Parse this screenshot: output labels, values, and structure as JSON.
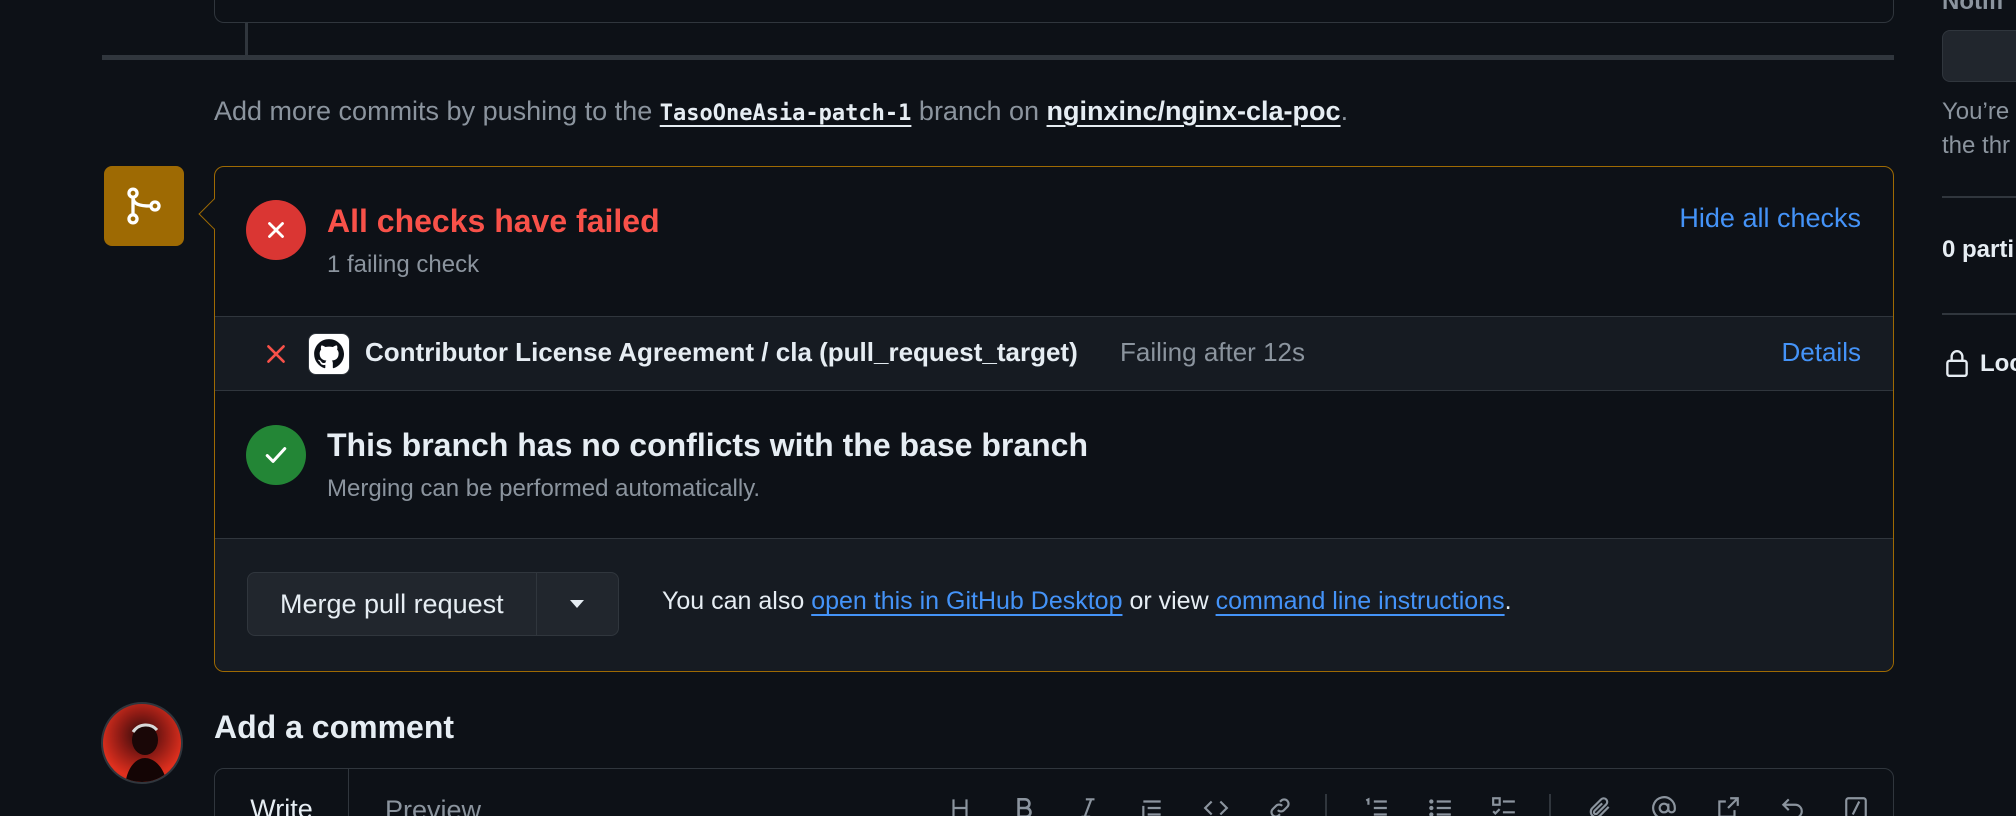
{
  "timeline": {
    "push_hint_prefix": "Add more commits by pushing to the",
    "branch_name": "TasoOneAsia-patch-1",
    "push_hint_middle": "branch on",
    "repo_name": "nginxinc/nginx-cla-poc",
    "push_hint_suffix": "."
  },
  "merge_box": {
    "checks": {
      "title": "All checks have failed",
      "subtitle": "1 failing check",
      "toggle_label": "Hide all checks",
      "items": [
        {
          "name": "Contributor License Agreement / cla (pull_request_target)",
          "status": "Failing after 12s",
          "details_label": "Details",
          "state": "failed",
          "icon": "github-icon"
        }
      ]
    },
    "conflicts": {
      "title": "This branch has no conflicts with the base branch",
      "subtitle": "Merging can be performed automatically."
    },
    "merge": {
      "button_label": "Merge pull request",
      "alt_prefix": "You can also",
      "desktop_link": "open this in GitHub Desktop",
      "alt_middle": "or view",
      "cli_link": "command line instructions",
      "alt_suffix": "."
    }
  },
  "comment": {
    "title": "Add a comment",
    "tabs": [
      "Write",
      "Preview"
    ],
    "toolbar_icons": [
      "heading-icon",
      "bold-icon",
      "italic-icon",
      "quote-icon",
      "code-icon",
      "link-icon",
      "ordered-list-icon",
      "unordered-list-icon",
      "task-list-icon",
      "attach-icon",
      "mention-icon",
      "cross-reference-icon",
      "reply-icon",
      "slash-command-icon"
    ]
  },
  "sidebar": {
    "heading_partial": "Notifi",
    "notice_line1": "You’re",
    "notice_line2": "the thr",
    "participants": "0 parti",
    "lock_label": "Loc"
  },
  "colors": {
    "background": "#0d1117",
    "failure": "#da3633",
    "failure_text": "#f85149",
    "success": "#238636",
    "link": "#4493f8",
    "merge_border": "#9e6a03"
  }
}
